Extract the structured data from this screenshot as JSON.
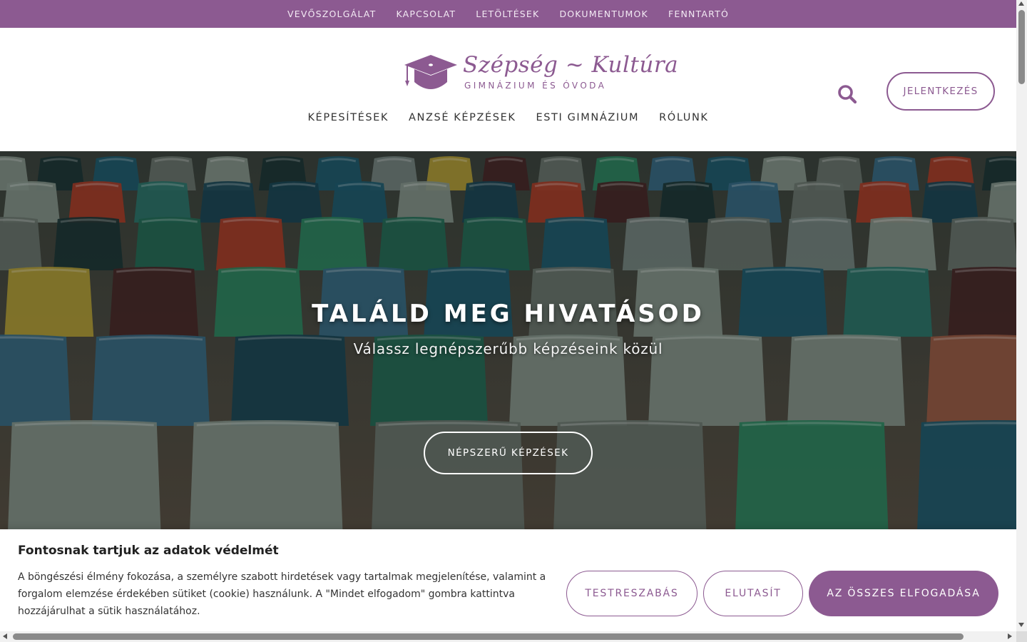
{
  "topbar": {
    "links": [
      "VEVŐSZOLGÁLAT",
      "KAPCSOLAT",
      "LETÖLTÉSEK",
      "DOKUMENTUMOK",
      "FENNTARTÓ"
    ]
  },
  "logo": {
    "title": "Szépség ~ Kultúra",
    "subtitle": "GIMNÁZIUM ÉS ÓVODA",
    "icon": "graduation-cap-icon"
  },
  "nav": {
    "items": [
      "KÉPESÍTÉSEK",
      "ANZSÉ KÉPZÉSEK",
      "ESTI GIMNÁZIUM",
      "RÓLUNK"
    ]
  },
  "header": {
    "search_icon": "search-icon",
    "apply_label": "JELENTKEZÉS"
  },
  "hero": {
    "title": "TALÁLD MEG HIVATÁSOD",
    "subtitle": "Válassz legnépszerűbb képzéseink közül",
    "button_label": "NÉPSZERŰ KÉPZÉSEK"
  },
  "cookie": {
    "title": "Fontosnak tartjuk az adatok védelmét",
    "text": "A böngészési élmény fokozása, a személyre szabott hirdetések vagy tartalmak megjelenítése, valamint a forgalom elemzése érdekében sütiket (cookie) használunk. A \"Mindet elfogadom\" gombra kattintva hozzájárulhat a sütik használatához.",
    "customize_label": "TESTRESZABÁS",
    "reject_label": "ELUTASÍT",
    "accept_label": "AZ ÖSSZES ELFOGADÁSA"
  },
  "colors": {
    "brand": "#8c5a91",
    "topbar_bg": "#8c5a91",
    "accept_bg": "#8c5a91"
  }
}
